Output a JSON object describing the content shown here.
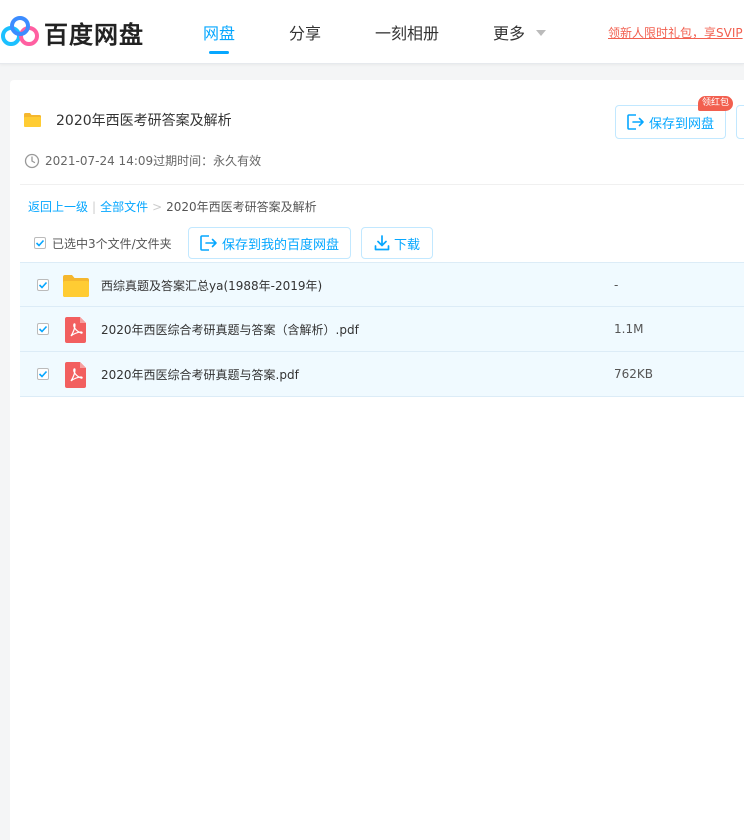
{
  "header": {
    "logo_text": "百度网盘",
    "nav": [
      {
        "label": "网盘",
        "active": true
      },
      {
        "label": "分享",
        "active": false
      },
      {
        "label": "一刻相册",
        "active": false
      },
      {
        "label": "更多",
        "active": false
      }
    ],
    "promo_text": "领新人限时礼包，享SVIP"
  },
  "share": {
    "title": "2020年西医考研答案及解析",
    "date": "2021-07-24 14:09",
    "expire_label": "过期时间：",
    "expire_value": "永久有效",
    "save_button": "保存到网盘",
    "badge": "领红包"
  },
  "breadcrumb": {
    "back": "返回上一级",
    "all_files": "全部文件",
    "separator_1": "|",
    "separator_2": ">",
    "current": "2020年西医考研答案及解析"
  },
  "toolbar": {
    "selection_label": "已选中3个文件/文件夹",
    "save_button": "保存到我的百度网盘",
    "download_button": "下载"
  },
  "files": [
    {
      "name": "西综真题及答案汇总ya(1988年-2019年)",
      "size": "-",
      "type": "folder",
      "checked": true
    },
    {
      "name": "2020年西医综合考研真题与答案（含解析）.pdf",
      "size": "1.1M",
      "type": "pdf",
      "checked": true
    },
    {
      "name": "2020年西医综合考研真题与答案.pdf",
      "size": "762KB",
      "type": "pdf",
      "checked": true
    }
  ],
  "colors": {
    "accent": "#06a7ff",
    "promo_red": "#f25f4f",
    "selected_row_bg": "#f0faff",
    "folder_yellow": "#ffcc33",
    "pdf_red": "#f25f5f"
  }
}
